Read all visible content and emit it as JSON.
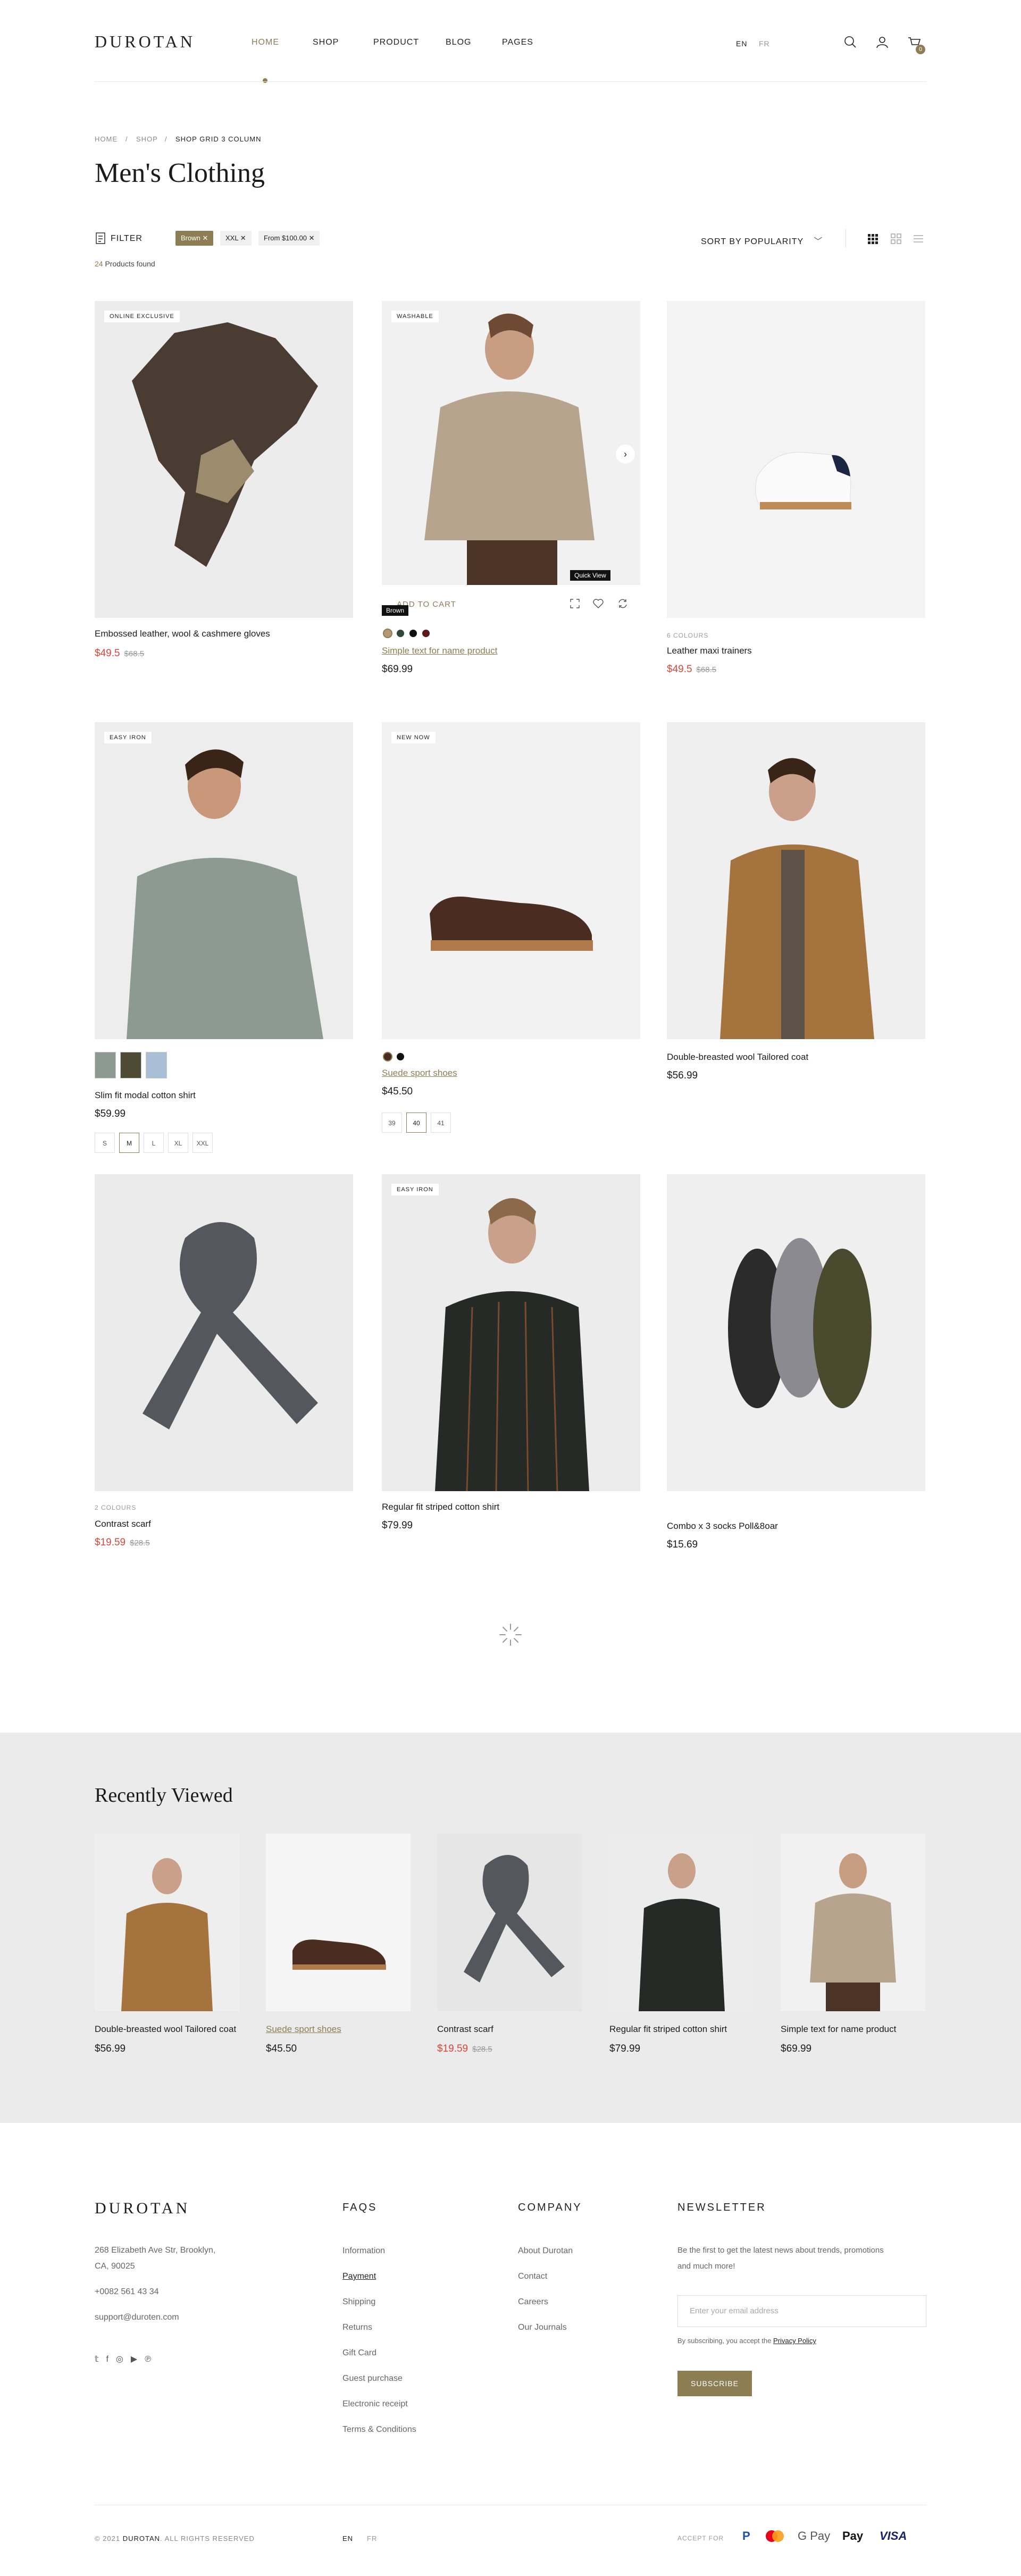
{
  "header": {
    "logo": "DUROTAN",
    "nav": [
      "HOME",
      "SHOP",
      "PRODUCT",
      "BLOG",
      "PAGES"
    ],
    "lang_en": "EN",
    "lang_fr": "FR",
    "cart_count": "0"
  },
  "breadcrumb": [
    "HOME",
    "/",
    "SHOP",
    "/",
    "SHOP GRID 3 COLUMN"
  ],
  "page_title": "Men's Clothing",
  "filters": {
    "label": "FILTER",
    "chips": [
      "Brown",
      "XXL",
      "From $100.00"
    ],
    "count_num": "24",
    "count_text": "Products found",
    "sort": "SORT BY POPULARITY"
  },
  "products": [
    {
      "badge": "ONLINE EXCLUSIVE",
      "name": "Embossed leather, wool & cashmere gloves",
      "price": "$49.5",
      "old": "$68.5"
    },
    {
      "badge": "WASHABLE",
      "name": "Simple text for name product",
      "price": "$69.99",
      "add_to_cart": "ADD TO CART",
      "tooltip_quick": "Quick View",
      "tooltip_colour": "Brown"
    },
    {
      "colours": "6 COLOURS",
      "name": "Leather maxi trainers",
      "price": "$49.5",
      "old": "$68.5"
    },
    {
      "badge": "EASY IRON",
      "name": "Slim fit modal cotton shirt",
      "price": "$59.99",
      "sizes": [
        "S",
        "M",
        "L",
        "XL",
        "XXL"
      ]
    },
    {
      "badge": "NEW NOW",
      "name": "Suede sport shoes",
      "price": "$45.50",
      "sizes": [
        "39",
        "40",
        "41"
      ]
    },
    {
      "name": "Double-breasted wool Tailored coat",
      "price": "$56.99"
    },
    {
      "colours": "2 COLOURS",
      "name": "Contrast scarf",
      "price": "$19.59",
      "old": "$28.5"
    },
    {
      "badge": "EASY IRON",
      "name": "Regular fit striped cotton shirt",
      "price": "$79.99"
    },
    {
      "name": "Combo x 3 socks Poll&8oar",
      "price": "$15.69"
    }
  ],
  "recent": {
    "title": "Recently Viewed",
    "items": [
      {
        "name": "Double-breasted wool Tailored coat",
        "price": "$56.99"
      },
      {
        "name": "Suede sport shoes",
        "price": "$45.50"
      },
      {
        "name": "Contrast scarf",
        "price": "$19.59",
        "old": "$28.5"
      },
      {
        "name": "Regular fit striped cotton shirt",
        "price": "$79.99"
      },
      {
        "name": "Simple text for name product",
        "price": "$69.99"
      }
    ]
  },
  "footer": {
    "logo": "DUROTAN",
    "address1": "268 Elizabeth Ave Str, Brooklyn,",
    "address2": "CA, 90025",
    "phone": "+0082 561 43 34",
    "email": "support@duroten.com",
    "faqs_title": "FAQS",
    "faqs": [
      "Information",
      "Payment",
      "Shipping",
      "Returns",
      "Gift Card",
      "Guest purchase",
      "Electronic receipt",
      "Terms & Conditions"
    ],
    "company_title": "COMPANY",
    "company": [
      "About Durotan",
      "Contact",
      "Careers",
      "Our Journals"
    ],
    "newsletter_title": "NEWSLETTER",
    "newsletter_text1": "Be the first to get the latest news about trends, promotions",
    "newsletter_text2": "and much more!",
    "email_placeholder": "Enter your email address",
    "consent_prefix": "By subscribing, you accept the",
    "consent_link": "Privacy Policy",
    "subscribe": "SUBSCRIBE",
    "copy_prefix": "© 2021",
    "copy_brand": "DUROTAN",
    "copy_suffix": ". ALL RIGHTS RESERVED",
    "lang_en": "EN",
    "lang_fr": "FR",
    "accept_for": "ACCEPT FOR",
    "payments": [
      "P",
      "G Pay",
      "Pay",
      "VISA"
    ]
  },
  "colors": {
    "accent": "#8c7d52",
    "sale": "#d9473a",
    "recent_bg": "#ebebeb"
  }
}
